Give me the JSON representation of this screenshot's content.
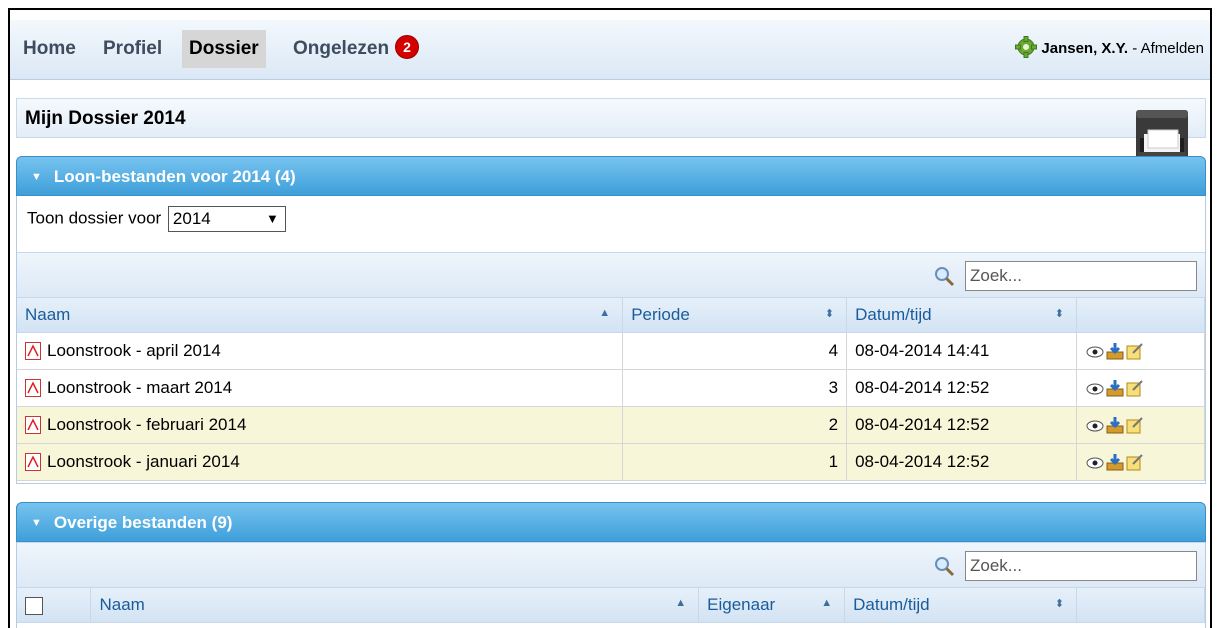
{
  "nav": {
    "items": [
      {
        "label": "Home"
      },
      {
        "label": "Profiel"
      },
      {
        "label": "Dossier"
      },
      {
        "label": "Ongelezen"
      }
    ],
    "unread_count": "2",
    "user_name": "Jansen, X.Y.",
    "separator": " - ",
    "logout_label": "Afmelden"
  },
  "page": {
    "title": "Mijn Dossier 2014"
  },
  "loon": {
    "header": "Loon-bestanden voor 2014 (4)",
    "show_label": "Toon dossier voor",
    "year_value": "2014",
    "search_placeholder": "Zoek...",
    "columns": [
      "Naam",
      "Periode",
      "Datum/tijd"
    ],
    "rows": [
      {
        "name": "Loonstrook - april 2014",
        "period": "4",
        "date": "08-04-2014 14:41"
      },
      {
        "name": "Loonstrook - maart 2014",
        "period": "3",
        "date": "08-04-2014 12:52"
      },
      {
        "name": "Loonstrook - februari 2014",
        "period": "2",
        "date": "08-04-2014 12:52"
      },
      {
        "name": "Loonstrook - januari 2014",
        "period": "1",
        "date": "08-04-2014 12:52"
      }
    ]
  },
  "overige": {
    "header": "Overige bestanden (9)",
    "search_placeholder": "Zoek...",
    "columns": [
      "Naam",
      "Eigenaar",
      "Datum/tijd"
    ]
  },
  "icons": {
    "collapse": "triangle-down-icon",
    "settings": "gear-icon",
    "file": "pdf-icon",
    "view": "eye-icon",
    "download": "download-icon",
    "edit": "edit-note-icon",
    "search": "magnifier-icon",
    "cabinet": "filing-cabinet-icon"
  },
  "colors": {
    "panel_header": "#4aa8e0",
    "badge": "#d40000",
    "highlight_row": "#f8f6d9"
  }
}
